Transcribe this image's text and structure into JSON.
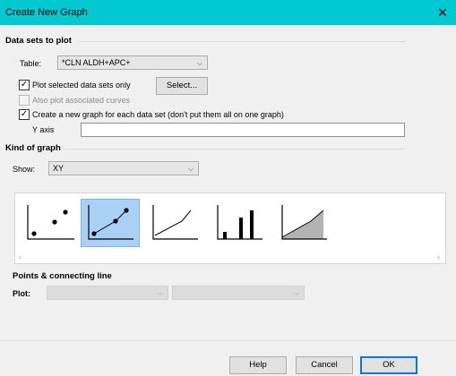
{
  "window": {
    "title": "Create New Graph"
  },
  "datasets": {
    "heading": "Data sets to plot",
    "table_label": "Table:",
    "table_value": "*CLN ALDH+APC+",
    "plot_selected_label": "Plot selected data sets only",
    "plot_selected_checked": true,
    "select_button": "Select...",
    "associated_curves_label": "Also plot associated curves",
    "associated_curves_checked": false,
    "new_graph_label": "Create a new graph for each data set (don't put them all on one graph)",
    "new_graph_checked": true,
    "y_axis_label": "Y axis",
    "y_axis_value": ""
  },
  "kind": {
    "heading": "Kind of graph",
    "show_label": "Show:",
    "show_value": "XY",
    "thumbnails": [
      "scatter-points-icon",
      "points-and-line-icon",
      "line-only-icon",
      "spikes-icon",
      "area-fill-icon"
    ],
    "selected_index": 1
  },
  "points": {
    "heading": "Points & connecting line",
    "plot_label": "Plot:",
    "plot_value_1": "",
    "plot_value_2": ""
  },
  "footer": {
    "help": "Help",
    "cancel": "Cancel",
    "ok": "OK"
  },
  "colors": {
    "titlebar": "#00c9d2",
    "selection": "#aad0f5",
    "ok_border": "#0078d7"
  }
}
